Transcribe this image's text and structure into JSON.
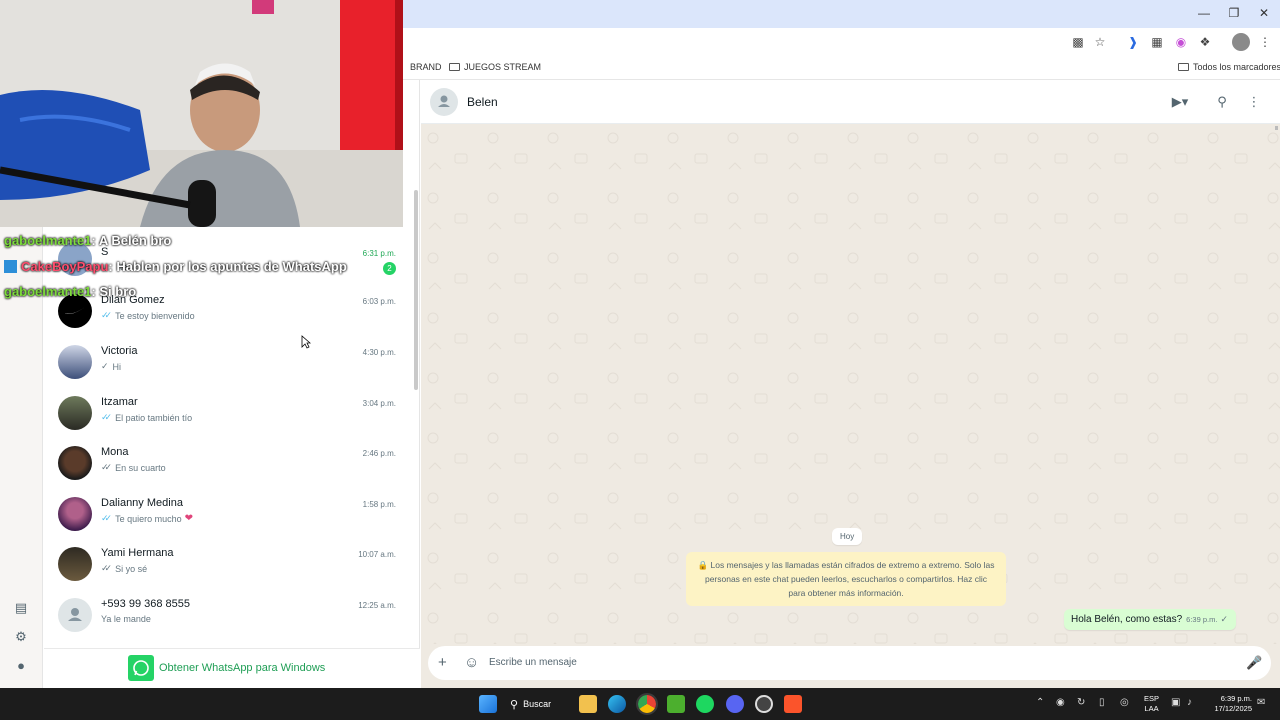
{
  "browser": {
    "bookmarks": [
      {
        "label": "BRAND"
      },
      {
        "label": "JUEGOS STREAM"
      }
    ],
    "all_bookmarks_label": "Todos los marcadores"
  },
  "chat_overlay": [
    {
      "user": "gaboelmante1",
      "text": ": A Belén bro",
      "user_color": "#7ddc3c"
    },
    {
      "user": "CakeBoyPapu",
      "text": ": Hablen por los apuntes de WhatsApp",
      "user_color": "#ff4d6d"
    },
    {
      "user": "gaboelmante1",
      "text": ": Si bro",
      "user_color": "#7ddc3c"
    }
  ],
  "chat_list": {
    "partial_row": {
      "name": "S",
      "time": "6:31 p.m.",
      "unread": "2",
      "preview_fragment": "te"
    },
    "chats": [
      {
        "name": "Dilan Gomez",
        "time": "6:03 p.m.",
        "preview": "Te estoy bienvenido",
        "tick": "double-blue"
      },
      {
        "name": "Victoria",
        "time": "4:30 p.m.",
        "preview": "Hi",
        "tick": "single-grey"
      },
      {
        "name": "Itzamar",
        "time": "3:04 p.m.",
        "preview": "El patio también tío",
        "tick": "double-blue"
      },
      {
        "name": "Mona",
        "time": "2:46 p.m.",
        "preview": "En su cuarto",
        "tick": "double-grey"
      },
      {
        "name": "Dalianny Medina",
        "time": "1:58 p.m.",
        "preview": "Te quiero mucho",
        "tick": "double-blue"
      },
      {
        "name": "Yami Hermana",
        "time": "10:07 a.m.",
        "preview": "Si yo sé",
        "tick": "double-grey"
      },
      {
        "name": "+593 99 368 8555",
        "time": "12:25 a.m.",
        "preview": "Ya le mande",
        "tick": ""
      }
    ],
    "get_app_label": "Obtener WhatsApp para Windows"
  },
  "conversation": {
    "contact_name": "Belen",
    "date_chip": "Hoy",
    "encryption_notice": "Los mensajes y las llamadas están cifrados de extremo a extremo. Solo las personas en este chat pueden leerlos, escucharlos o compartirlos. Haz clic para obtener más información.",
    "messages": [
      {
        "text": "Hola Belén, como estas?",
        "time": "6:39 p.m.",
        "direction": "outgoing",
        "tick": "single-grey"
      }
    ],
    "composer_placeholder": "Escribe un mensaje"
  },
  "taskbar": {
    "search_label": "Buscar",
    "lang_top": "ESP",
    "lang_bottom": "LAA",
    "time": "6:39 p.m.",
    "date": "17/12/2025"
  },
  "colors": {
    "whatsapp_green": "#25d366",
    "read_tick": "#53bdeb",
    "outgoing_bubble": "#d9fdd3",
    "chat_bg": "#efeae2"
  }
}
